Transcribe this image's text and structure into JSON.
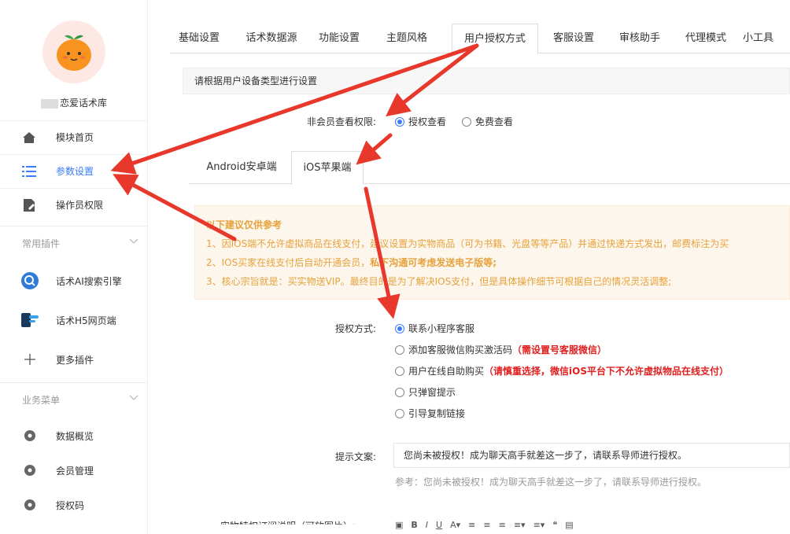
{
  "sidebar": {
    "app_name": "恋爱话术库",
    "menu": [
      {
        "label": "模块首页",
        "icon": "home-icon"
      },
      {
        "label": "参数设置",
        "icon": "list-icon",
        "active": true
      },
      {
        "label": "操作员权限",
        "icon": "file-edit-icon"
      }
    ],
    "plugins_title": "常用插件",
    "plugins": [
      {
        "label": "话术AI搜索引擎",
        "icon": "search-ai-icon"
      },
      {
        "label": "话术H5网页端",
        "icon": "h5-web-icon"
      },
      {
        "label": "更多插件",
        "icon": "plus-icon"
      }
    ],
    "business_title": "业务菜单",
    "business": [
      {
        "label": "数据概览",
        "icon": "gear-icon"
      },
      {
        "label": "会员管理",
        "icon": "gear-icon"
      },
      {
        "label": "授权码",
        "icon": "gear-icon"
      }
    ]
  },
  "topnav": {
    "tabs": [
      "基础设置",
      "话术数据源",
      "功能设置",
      "主题风格",
      "用户授权方式",
      "客服设置",
      "审核助手",
      "代理模式",
      "小工具"
    ],
    "active_index": 4
  },
  "panel": {
    "header": "请根据用户设备类型进行设置",
    "nonmember_label": "非会员查看权限:",
    "nonmember_options": [
      "授权查看",
      "免费查看"
    ],
    "nonmember_selected": 0,
    "subtabs": [
      "Android安卓端",
      "iOS苹果端"
    ],
    "subtab_active": 1,
    "notice": {
      "title": "以下建议仅供参考",
      "line1": "1、因IOS端不允许虚拟商品在线支付，建议设置为实物商品（可为书籍、光盘等等产品）并通过快递方式发出，邮费标注为买",
      "line2_a": "2、IOS买家在线支付后自动开通会员，",
      "line2_b": "私下沟通可考虑发送电子版等;",
      "line3": "3、核心宗旨就是：买实物送VIP。最终目的是为了解决IOS支付，但是具体操作细节可根据自己的情况灵活调整;"
    },
    "auth_label": "授权方式:",
    "auth_options": [
      {
        "text": "联系小程序客服",
        "note": ""
      },
      {
        "text": "添加客服微信购买激活码",
        "note": "（需设置号客服微信）"
      },
      {
        "text": "用户在线自助购买",
        "note": "（请慎重选择，微信iOS平台下不允许虚拟物品在线支付）"
      },
      {
        "text": "只弹窗提示",
        "note": ""
      },
      {
        "text": "引导复制链接",
        "note": ""
      }
    ],
    "auth_selected": 0,
    "tip_label": "提示文案:",
    "tip_value": "您尚未被授权！成为聊天高手就差这一步了，请联系导师进行授权。",
    "tip_hint": "参考：您尚未被授权！成为聊天高手就差这一步了，请联系导师进行授权。",
    "bottom_label": "实物特权订阅说明（可放图片）:"
  },
  "colors": {
    "accent": "#3a7bff",
    "arrow": "#e8382b",
    "notice_bg": "#fdf6ec",
    "notice_text": "#e6a23c",
    "warning": "#e02020"
  }
}
